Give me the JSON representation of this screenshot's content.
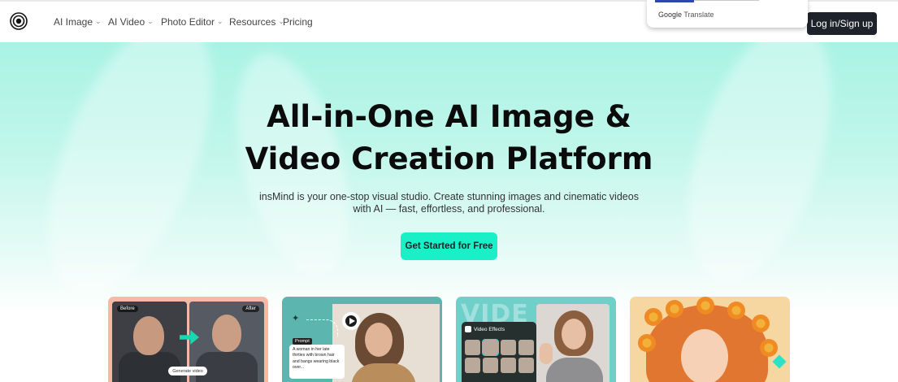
{
  "nav": {
    "logo_icon": "spiral-logo-icon",
    "items": [
      {
        "label": "AI Image",
        "has_dropdown": true
      },
      {
        "label": "AI Video",
        "has_dropdown": true
      },
      {
        "label": "Photo Editor",
        "has_dropdown": true
      },
      {
        "label": "Resources",
        "has_dropdown": true
      },
      {
        "label": "Pricing",
        "has_dropdown": false
      }
    ],
    "login_label": "Log in/Sign up"
  },
  "google_translate": {
    "brand": "Google",
    "label": "Translate"
  },
  "hero": {
    "headline_line1": "All-in-One AI Image &",
    "headline_line2": "Video Creation Platform",
    "subtitle_line1": "insMind is your one-stop visual studio. Create stunning images and cinematic videos",
    "subtitle_line2": "with AI — fast, effortless, and professional.",
    "cta_label": "Get Started for Free"
  },
  "cards": {
    "card1": {
      "before_tag": "Before",
      "after_tag": "After",
      "generate_label": "Generate video"
    },
    "card2": {
      "prompt_tag": "Prompt",
      "prompt_text": "A woman in her late thirties with brown hair and bangs wearing black over..."
    },
    "card3": {
      "bg_text": "VIDE",
      "panel_title": "Video Effects"
    },
    "card4": {}
  },
  "colors": {
    "accent": "#19f0c8",
    "login_bg": "#1e232b",
    "hero_top": "#a9f3e4",
    "card1_bg": "#f5b9a5",
    "card2_bg": "#5cb5af",
    "card3_bg": "#6fd0c9",
    "card4_bg": "#f6d7a2"
  }
}
